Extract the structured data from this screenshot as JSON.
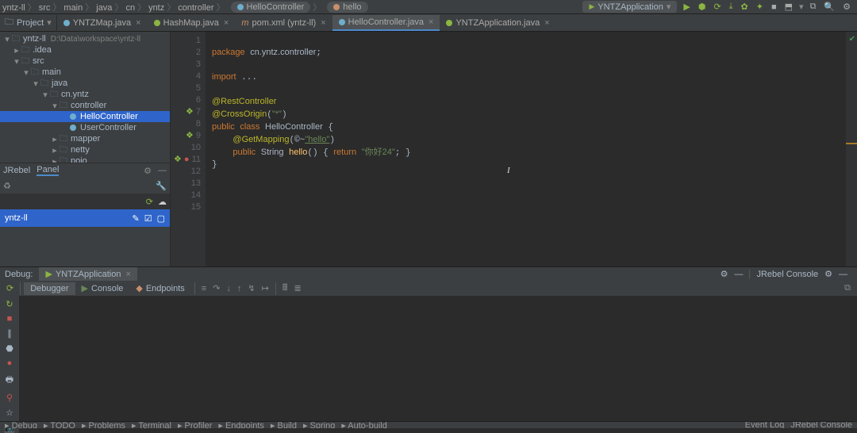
{
  "breadcrumbs": [
    "yntz-ll",
    "src",
    "main",
    "java",
    "cn",
    "yntz",
    "controller",
    "HelloController",
    "hello"
  ],
  "runConfig": "YNTZApplication",
  "topToolIcons": [
    "▶",
    "⬢",
    "⟳",
    "⤵",
    "✿",
    "⚙",
    "JRebel",
    "⬒",
    "⬛",
    "⬚"
  ],
  "projDropdown": "Project",
  "editorTabs": [
    {
      "icon": "icon-class",
      "label": "YNTZMap.java",
      "active": false
    },
    {
      "icon": "icon-class-o",
      "label": "HashMap.java",
      "active": false
    },
    {
      "icon": "",
      "label": "pom.xml (yntz-ll)",
      "active": false,
      "mlabel": true
    },
    {
      "icon": "icon-class",
      "label": "HelloController.java",
      "active": true
    },
    {
      "icon": "icon-class-o",
      "label": "YNTZApplication.java",
      "active": false
    }
  ],
  "tree": [
    {
      "indent": 0,
      "arrow": "▾",
      "icon": "📁",
      "label": "yntz-ll",
      "suffix": "D:\\Data\\workspace\\yntz-ll"
    },
    {
      "indent": 1,
      "arrow": "▸",
      "icon": "📁",
      "label": ".idea"
    },
    {
      "indent": 1,
      "arrow": "▾",
      "icon": "📁",
      "label": "src"
    },
    {
      "indent": 2,
      "arrow": "▾",
      "icon": "📁",
      "label": "main"
    },
    {
      "indent": 3,
      "arrow": "▾",
      "icon": "📁",
      "label": "java"
    },
    {
      "indent": 4,
      "arrow": "▾",
      "icon": "📁",
      "label": "cn.yntz"
    },
    {
      "indent": 5,
      "arrow": "▾",
      "icon": "📁",
      "label": "controller"
    },
    {
      "indent": 6,
      "arrow": "",
      "icon": "●",
      "label": "HelloController",
      "selected": true
    },
    {
      "indent": 6,
      "arrow": "",
      "icon": "●",
      "label": "UserController"
    },
    {
      "indent": 5,
      "arrow": "▸",
      "icon": "📁",
      "label": "mapper"
    },
    {
      "indent": 5,
      "arrow": "▸",
      "icon": "📁",
      "label": "netty"
    },
    {
      "indent": 5,
      "arrow": "▸",
      "icon": "📁",
      "label": "poio"
    }
  ],
  "jrebel": {
    "tabs": [
      "JRebel",
      "Panel"
    ],
    "boxLabel": "yntz-ll"
  },
  "lineNumbers": [
    "1",
    "2",
    "3",
    "4",
    "5",
    "6",
    "7",
    "8",
    "9",
    "10",
    "11",
    "12",
    "13",
    "14",
    "15"
  ],
  "code": {
    "pkg": "cn.yntz.controller",
    "l7": "@RestController",
    "l8a": "@CrossOrigin",
    "l8b": "\"*\"",
    "l9a": "HelloController",
    "l10a": "@GetMapping",
    "l10b": "\"hello\"",
    "l11a": "String",
    "l11b": "hello",
    "l11c": "\"你好24\""
  },
  "debug": {
    "title": "Debug:",
    "runTab": "YNTZApplication",
    "rightTabs": [
      "JRebel Console"
    ],
    "tabs": [
      "Debugger",
      "Console",
      "Endpoints"
    ]
  },
  "status": {
    "left": [
      "Debug",
      "TODO",
      "Problems",
      "Terminal",
      "Profiler",
      "Endpoints",
      "Build",
      "Spring",
      "Auto-build"
    ],
    "right": [
      "Event Log",
      "JRebel Console"
    ]
  }
}
